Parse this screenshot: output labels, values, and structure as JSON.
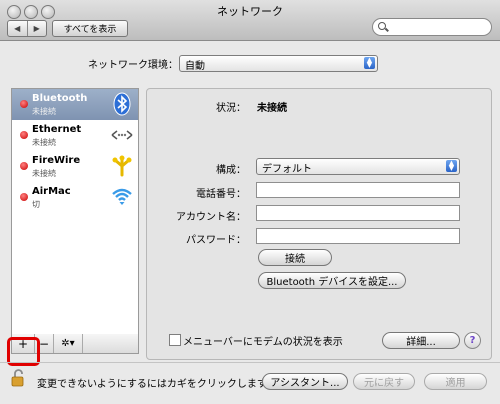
{
  "window": {
    "title": "ネットワーク"
  },
  "toolbar": {
    "show_all_label": "すべてを表示",
    "back_icon": "◀",
    "forward_icon": "▶",
    "search_placeholder": ""
  },
  "location": {
    "label": "ネットワーク環境：",
    "value": "自動"
  },
  "sidebar": {
    "items": [
      {
        "name": "Bluetooth",
        "status": "未接続",
        "icon": "bluetooth-icon",
        "selected": true
      },
      {
        "name": "Ethernet",
        "status": "未接続",
        "icon": "ethernet-icon",
        "selected": false
      },
      {
        "name": "FireWire",
        "status": "未接続",
        "icon": "firewire-icon",
        "selected": false
      },
      {
        "name": "AirMac",
        "status": "切",
        "icon": "wifi-icon",
        "selected": false
      }
    ],
    "add_label": "+",
    "remove_label": "−",
    "action_label": "✲▾"
  },
  "detail": {
    "status_label": "状況：",
    "status_value": "未接続",
    "config_label": "構成：",
    "config_value": "デフォルト",
    "phone_label": "電話番号：",
    "phone_value": "",
    "account_label": "アカウント名：",
    "account_value": "",
    "password_label": "パスワード：",
    "password_value": "",
    "connect_button": "接続",
    "setup_button": "Bluetooth デバイスを設定...",
    "menubar_checkbox_label": "メニューバーにモデムの状況を表示",
    "advanced_button": "詳細...",
    "help_label": "?"
  },
  "footer": {
    "lock_text": "変更できないようにするにはカギをクリックします。",
    "assistant_button": "アシスタント...",
    "revert_button": "元に戻す",
    "apply_button": "適用"
  },
  "colors": {
    "selection": "#8ea2bf",
    "status_red": "#d40000",
    "accent_blue": "#2a64c8",
    "highlight_box": "#e00000"
  }
}
